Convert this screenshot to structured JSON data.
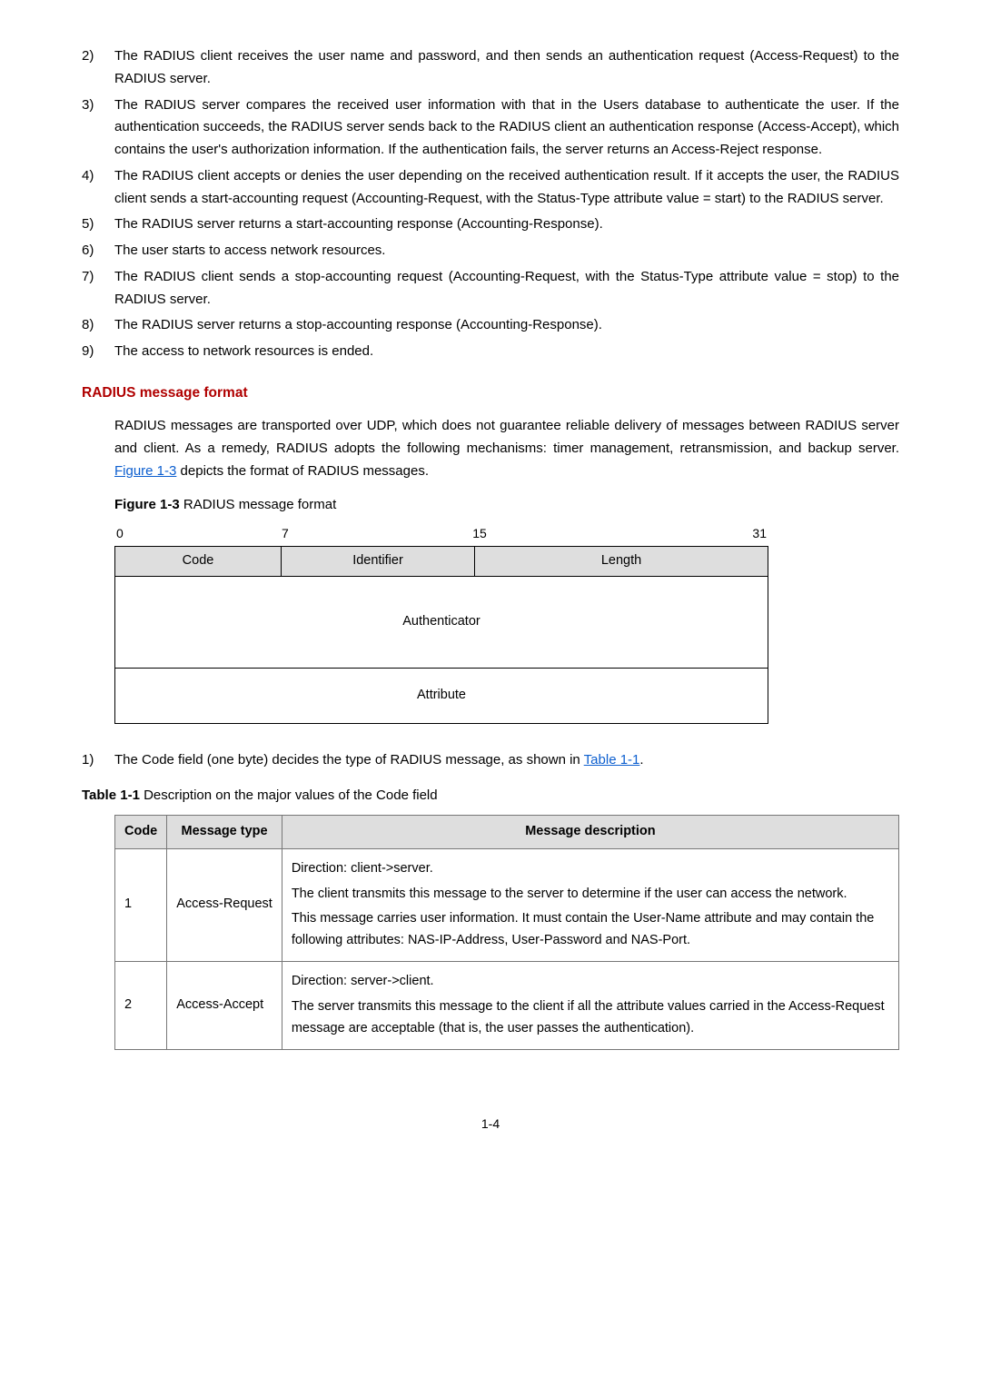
{
  "list": {
    "items": [
      {
        "n": "2)",
        "t": "The RADIUS client receives the user name and password, and then sends an authentication request (Access-Request) to the RADIUS server."
      },
      {
        "n": "3)",
        "t": "The RADIUS server compares the received user information with that in the Users database to authenticate the user. If the authentication succeeds, the RADIUS server sends back to the RADIUS client an authentication response (Access-Accept), which contains the user's authorization information. If the authentication fails, the server returns an Access-Reject response."
      },
      {
        "n": "4)",
        "t": "The RADIUS client accepts or denies the user depending on the received authentication result. If it accepts the user, the RADIUS client sends a start-accounting request (Accounting-Request, with the Status-Type attribute value = start) to the RADIUS server."
      },
      {
        "n": "5)",
        "t": "The RADIUS server returns a start-accounting response (Accounting-Response)."
      },
      {
        "n": "6)",
        "t": "The user starts to access network resources."
      },
      {
        "n": "7)",
        "t": "The RADIUS client sends a stop-accounting request (Accounting-Request, with the Status-Type attribute value = stop) to the RADIUS server."
      },
      {
        "n": "8)",
        "t": "The RADIUS server returns a stop-accounting response (Accounting-Response)."
      },
      {
        "n": "9)",
        "t": "The access to network resources is ended."
      }
    ]
  },
  "heading": "RADIUS message format",
  "intro_pre": "RADIUS messages are transported over UDP, which does not guarantee reliable delivery of messages between RADIUS server and client. As a remedy, RADIUS adopts the following mechanisms: timer management, retransmission, and backup server. ",
  "intro_link": "Figure 1-3",
  "intro_post": " depicts the format of RADIUS messages.",
  "figure": {
    "label": "Figure 1-3",
    "title": " RADIUS message format",
    "scale": {
      "s0": "0",
      "s7": "7",
      "s15": "15",
      "s31": "31"
    },
    "code": "Code",
    "id": "Identifier",
    "len": "Length",
    "auth": "Authenticator",
    "attr": "Attribute"
  },
  "code_line_pre": "1)",
  "code_line_text_a": "The Code field (one byte) decides the type of RADIUS message, as shown in ",
  "code_line_link": "Table 1-1",
  "code_line_text_b": ".",
  "table": {
    "label": "Table 1-1",
    "title": " Description on the major values of the Code field",
    "headers": {
      "code": "Code",
      "type": "Message type",
      "desc": "Message description"
    },
    "rows": [
      {
        "code": "1",
        "type": "Access-Request",
        "desc": [
          "Direction: client->server.",
          "The client transmits this message to the server to determine if the user can access the network.",
          "This message carries user information. It must contain the User-Name attribute and may contain the following attributes: NAS-IP-Address, User-Password and NAS-Port."
        ]
      },
      {
        "code": "2",
        "type": "Access-Accept",
        "desc": [
          "Direction: server->client.",
          "The server transmits this message to the client if all the attribute values carried in the Access-Request message are acceptable (that is, the user passes the authentication)."
        ]
      }
    ]
  },
  "pagenum": "1-4"
}
